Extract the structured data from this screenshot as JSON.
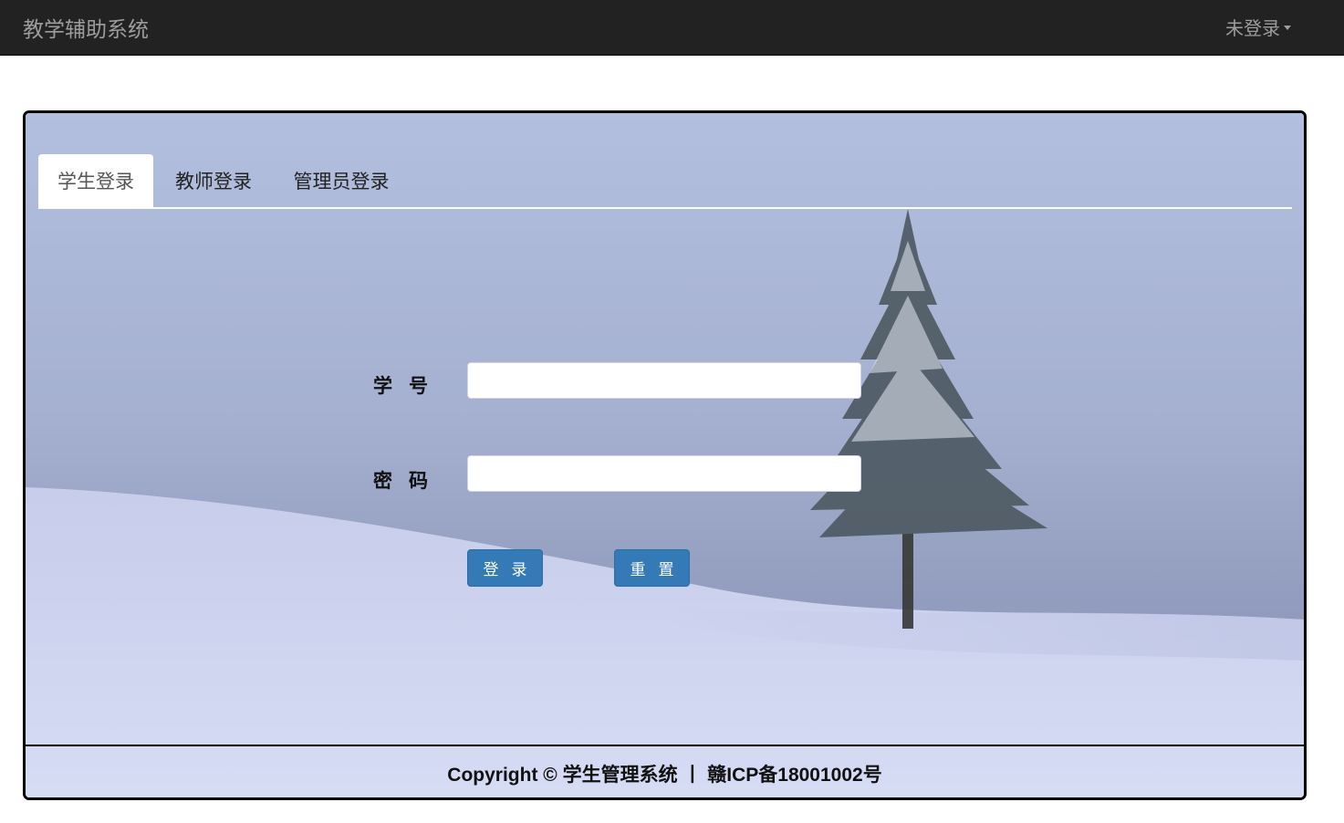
{
  "navbar": {
    "brand": "教学辅助系统",
    "user_menu": "未登录"
  },
  "tabs": [
    {
      "label": "学生登录",
      "active": true
    },
    {
      "label": "教师登录",
      "active": false
    },
    {
      "label": "管理员登录",
      "active": false
    }
  ],
  "form": {
    "id_label": "学号",
    "id_value": "",
    "password_label": "密码",
    "password_value": "",
    "login_button": "登录",
    "reset_button": "重置"
  },
  "footer": {
    "copyright": "Copyright © 学生管理系统 丨 赣ICP备18001002号"
  },
  "colors": {
    "navbar_bg": "#222222",
    "primary_button": "#337ab7",
    "sky": "#aab6d8",
    "snow": "#d4daf1"
  },
  "icons": {
    "user_menu_caret": "caret-down-icon"
  }
}
